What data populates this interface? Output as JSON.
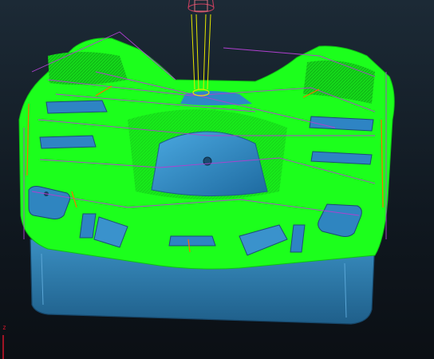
{
  "viewport": {
    "background_top": "#1c2a36",
    "background_bottom": "#0b0f14"
  },
  "model": {
    "part_color": "#2f7fb0",
    "part_edge_color": "#1d4f72",
    "toolpath_color": "#00ff1e",
    "toolpath_dark": "#12c81a",
    "rapid_move_color": "#b040d0",
    "lead_move_color": "#ff6a00",
    "tool_color": "#e6e600",
    "tool_holder_color": "#d04060"
  },
  "axis_triad": {
    "z_label": "z",
    "z_color": "#e0162b"
  }
}
